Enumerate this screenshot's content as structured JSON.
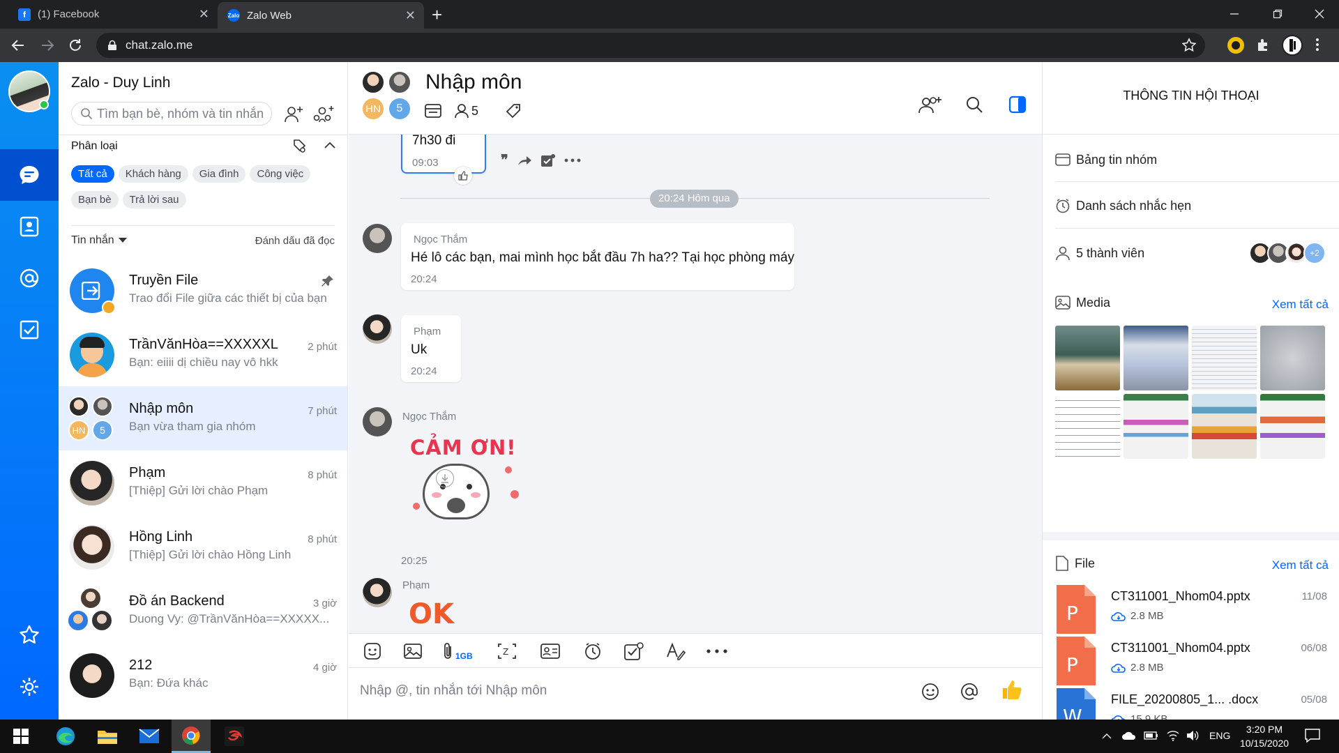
{
  "browser": {
    "tabs": [
      {
        "title": "(1) Facebook",
        "icon": "facebook-icon"
      },
      {
        "title": "Zalo Web",
        "icon": "zalo-icon"
      }
    ],
    "url": "chat.zalo.me"
  },
  "sidebar": {
    "app_title": "Zalo - Duy Linh",
    "search_placeholder": "Tìm bạn bè, nhóm và tin nhắn",
    "filter_label": "Phân loại",
    "chips": [
      "Tất cả",
      "Khách hàng",
      "Gia đình",
      "Công việc",
      "Bạn bè",
      "Trả lời sau"
    ],
    "messages_label": "Tin nhắn",
    "mark_read": "Đánh dấu đã đọc",
    "conversations": [
      {
        "name": "Truyền File",
        "preview": "Trao đổi File giữa các thiết bị của bạn",
        "time": ""
      },
      {
        "name": "TrầnVănHòa==XXXXXL",
        "preview": "Bạn: eiiii dị chiều nay vô hkk",
        "time": "2 phút"
      },
      {
        "name": "Nhập môn",
        "preview": "Bạn vừa tham gia nhóm",
        "time": "7 phút"
      },
      {
        "name": "Phạm",
        "preview": "[Thiệp] Gửi lời chào Phạm",
        "time": "8 phút"
      },
      {
        "name": "Hồng Linh",
        "preview": "[Thiệp] Gửi lời chào Hồng Linh",
        "time": "8 phút"
      },
      {
        "name": "Đồ án Backend",
        "preview": "Duong Vy: @TrầnVănHòa==XXXXX...",
        "time": "3 giờ"
      },
      {
        "name": "212",
        "preview": "Bạn: Đứa khác",
        "time": "4 giờ"
      }
    ],
    "group_badge_initials": "HN",
    "group_badge_count": "5"
  },
  "chat": {
    "title": "Nhập môn",
    "avatar_initials": "HN",
    "avatar_count": "5",
    "member_count": "5",
    "partial_message_text": "7h30 đi",
    "partial_message_time": "09:03",
    "date_divider": "20:24 Hôm qua",
    "messages": [
      {
        "sender": "Ngọc Thắm",
        "text": "Hé lô các bạn, mai mình học bắt đầu 7h ha?? Tại học phòng máy",
        "time": "20:24"
      },
      {
        "sender": "Phạm",
        "text": "Uk",
        "time": "20:24"
      },
      {
        "sender": "Ngọc Thắm",
        "sticker_text": "CẢM ƠN!",
        "time": "20:25"
      },
      {
        "sender": "Phạm",
        "sticker_text": "OK"
      }
    ],
    "attach_badge": "1GB",
    "input_placeholder": "Nhập @, tin nhắn tới Nhập môn"
  },
  "info": {
    "title": "THÔNG TIN HỘI THOẠI",
    "board": "Bảng tin nhóm",
    "reminders": "Danh sách nhắc hẹn",
    "members": "5 thành viên",
    "members_extra": "+2",
    "media_title": "Media",
    "file_title": "File",
    "see_all": "Xem tất cả",
    "files": [
      {
        "name": "CT311001_Nhom04.pptx",
        "size": "2.8 MB",
        "date": "11/08",
        "type": "P"
      },
      {
        "name": "CT311001_Nhom04.pptx",
        "size": "2.8 MB",
        "date": "06/08",
        "type": "P"
      },
      {
        "name": "FILE_20200805_1... .docx",
        "size": "15.9 KB",
        "date": "05/08",
        "type": "W"
      }
    ]
  },
  "taskbar": {
    "lang": "ENG",
    "time": "3:20 PM",
    "date": "10/15/2020"
  },
  "colors": {
    "accent": "#0068ff",
    "rail": "#0a8ff0",
    "ppt": "#f26d4a",
    "word": "#2a73d6"
  }
}
